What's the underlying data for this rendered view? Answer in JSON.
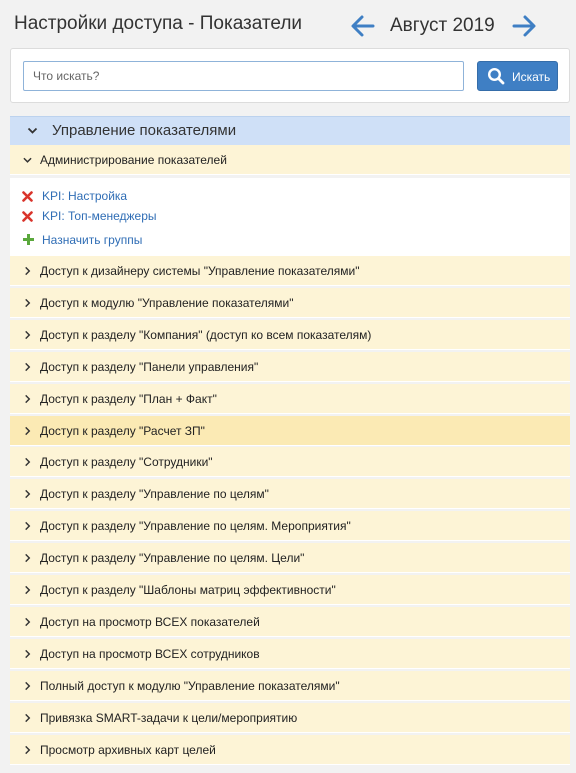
{
  "header": {
    "title": "Настройки доступа - Показатели",
    "month": "Август 2019",
    "prev_icon": "arrow-left-icon",
    "next_icon": "arrow-right-icon"
  },
  "search": {
    "placeholder": "Что искать?",
    "value": "",
    "button_label": "Искать",
    "button_icon": "search-icon"
  },
  "section": {
    "title": "Управление показателями"
  },
  "expanded_group": {
    "title": "Администрирование показателей",
    "items": [
      {
        "label": "KPI: Настройка"
      },
      {
        "label": "KPI: Топ-менеджеры"
      }
    ],
    "assign_label": "Назначить группы"
  },
  "groups": [
    {
      "label": "Доступ к дизайнеру системы \"Управление показателями\""
    },
    {
      "label": "Доступ к модулю \"Управление показателями\""
    },
    {
      "label": "Доступ к разделу \"Компания\" (доступ ко всем показателям)"
    },
    {
      "label": "Доступ к разделу \"Панели управления\""
    },
    {
      "label": "Доступ к разделу \"План + Факт\""
    },
    {
      "label": "Доступ к разделу \"Расчет ЗП\""
    },
    {
      "label": "Доступ к разделу \"Сотрудники\""
    },
    {
      "label": "Доступ к разделу \"Управление по целям\""
    },
    {
      "label": "Доступ к разделу \"Управление по целям. Мероприятия\""
    },
    {
      "label": "Доступ к разделу \"Управление по целям. Цели\""
    },
    {
      "label": "Доступ к разделу \"Шаблоны матриц эффективности\""
    },
    {
      "label": "Доступ на просмотр ВСЕХ показателей"
    },
    {
      "label": "Доступ на просмотр ВСЕХ сотрудников"
    },
    {
      "label": "Полный доступ к модулю \"Управление показателями\""
    },
    {
      "label": "Привязка SMART-задачи к цели/мероприятию"
    },
    {
      "label": "Просмотр архивных карт целей"
    }
  ],
  "colors": {
    "accent": "#3f7fc4",
    "section_bg": "#cfe0f7",
    "group_bg": "#fdf4d6",
    "group_highlight_bg": "#fbeab4",
    "link": "#2f6db5",
    "remove": "#d9342b",
    "add": "#5aa83c"
  }
}
